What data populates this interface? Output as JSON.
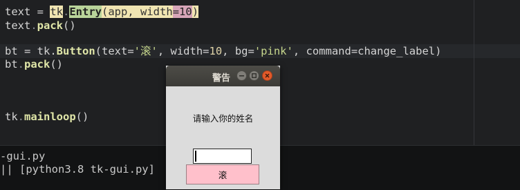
{
  "editor": {
    "lines": [
      {
        "parts": [
          "text = ",
          "tk",
          ".",
          "Entry",
          "(app, ",
          "width",
          "=",
          "10",
          ")"
        ]
      },
      {
        "parts": [
          "text",
          ".",
          "pack",
          "()"
        ]
      },
      {
        "parts": [
          "bt = tk.",
          "Button",
          "(text=",
          "'滚'",
          ", width=",
          "10",
          ", bg=",
          "'pink'",
          ", command=change_label)"
        ]
      },
      {
        "parts": [
          "bt",
          ".",
          "pack",
          "()"
        ]
      },
      {
        "parts": [
          "tk",
          ".",
          "mainloop",
          "()"
        ]
      }
    ]
  },
  "terminal": {
    "line1": "-gui.py",
    "line2": "|| [python3.8 tk-gui.py]"
  },
  "dialog": {
    "title": "警告",
    "prompt": "请输入你的姓名",
    "entry_value": "",
    "button_label": "滚"
  },
  "colors": {
    "button_bg": "#ffc0cb",
    "close_button": "#e35a2a",
    "titlebar": "#3c3b37"
  }
}
